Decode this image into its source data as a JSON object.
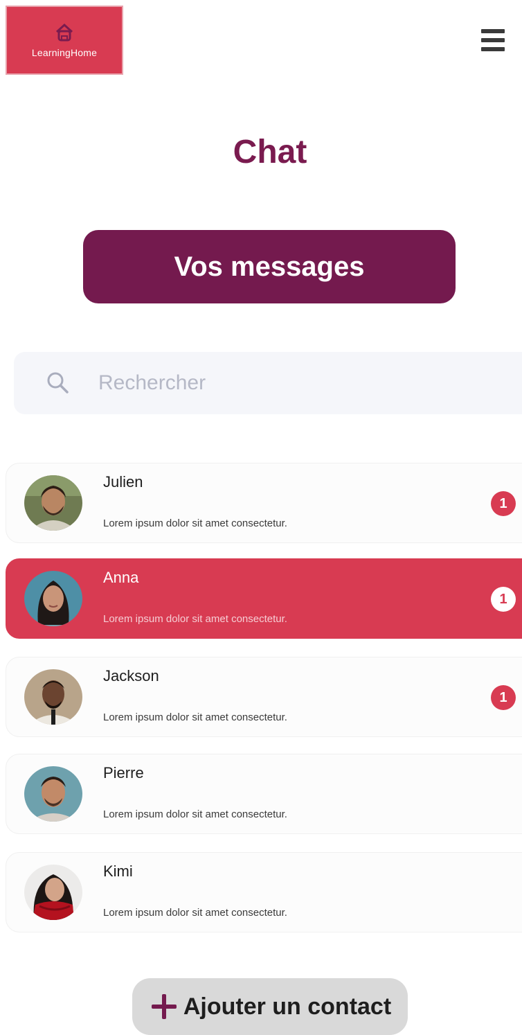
{
  "header": {
    "logo_text": "LearningHome",
    "menu_icon": "hamburger-icon"
  },
  "page": {
    "title": "Chat"
  },
  "tab": {
    "label": "Vos messages"
  },
  "search": {
    "placeholder": "Rechercher",
    "value": "",
    "icon": "search-icon"
  },
  "contacts": [
    {
      "name": "Julien",
      "preview": "Lorem ipsum dolor sit amet consectetur.",
      "unread": "1"
    },
    {
      "name": "Anna",
      "preview": "Lorem ipsum dolor sit amet consectetur.",
      "unread": "1"
    },
    {
      "name": "Jackson",
      "preview": "Lorem ipsum dolor sit amet consectetur.",
      "unread": "1"
    },
    {
      "name": "Pierre",
      "preview": "Lorem ipsum dolor sit amet consectetur.",
      "unread": ""
    },
    {
      "name": "Kimi",
      "preview": "Lorem ipsum dolor sit amet consectetur.",
      "unread": ""
    }
  ],
  "add_contact": {
    "label": "Ajouter un contact",
    "icon": "plus-icon"
  },
  "colors": {
    "brand": "#d83b52",
    "primary": "#741a4e",
    "title": "#7a1b4f"
  }
}
